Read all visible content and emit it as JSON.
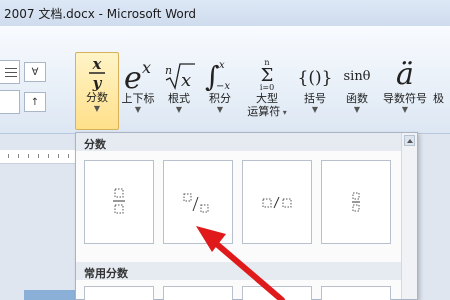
{
  "window": {
    "title": "2007 文档.docx - Microsoft Word"
  },
  "ribbon": {
    "mini_controls": [
      "∀",
      "↑"
    ],
    "buttons": [
      {
        "id": "fraction",
        "symbol": "x/y",
        "label": "分数",
        "active": true
      },
      {
        "id": "script",
        "symbol": "eˣ",
        "label": "上下标"
      },
      {
        "id": "radical",
        "symbol": "ⁿ√x",
        "label": "根式"
      },
      {
        "id": "integral",
        "symbol": "∫",
        "label": "积分"
      },
      {
        "id": "large_operator",
        "symbol": "Σ",
        "label": "大型",
        "label2": "运算符"
      },
      {
        "id": "bracket",
        "symbol": "{()}",
        "label": "括号"
      },
      {
        "id": "function",
        "symbol": "sinθ",
        "label": "函数"
      },
      {
        "id": "accent",
        "symbol": "ä",
        "label": "导数符号"
      },
      {
        "id": "limit",
        "symbol": "",
        "label": "极"
      }
    ]
  },
  "gallery": {
    "sections": [
      {
        "title": "分数"
      },
      {
        "title": "常用分数"
      }
    ],
    "tiles": [
      {
        "name": "stacked-fraction"
      },
      {
        "name": "skewed-fraction"
      },
      {
        "name": "linear-fraction"
      },
      {
        "name": "small-fraction"
      }
    ]
  }
}
